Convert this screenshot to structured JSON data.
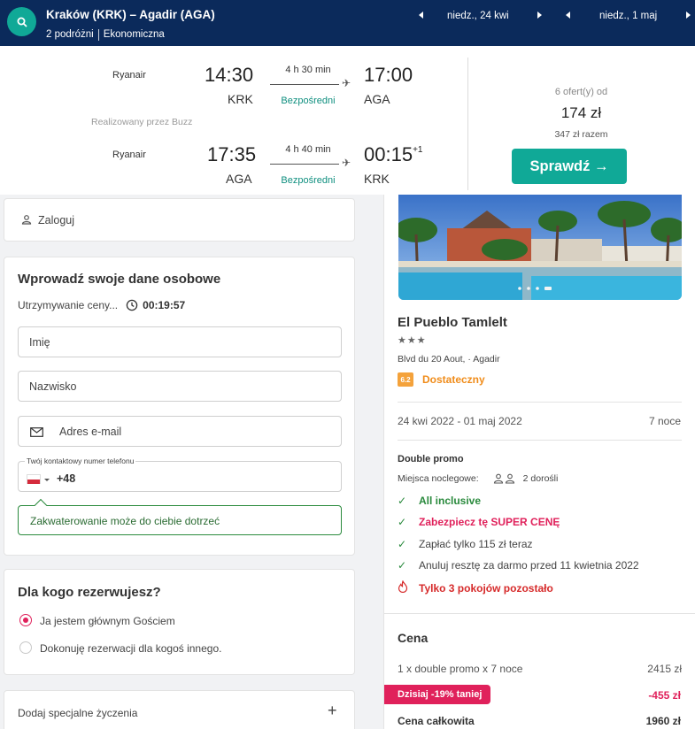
{
  "header": {
    "route": "Kraków (KRK) – Agadir (AGA)",
    "travellers": "2 podróżni",
    "cabin": "Ekonomiczna",
    "depart_date": "niedz., 24 kwi",
    "return_date": "niedz., 1 maj"
  },
  "flight": {
    "outbound": {
      "airline": "Ryanair",
      "dep_time": "14:30",
      "dep_code": "KRK",
      "duration": "4 h 30 min",
      "stops": "Bezpośredni",
      "arr_time": "17:00",
      "arr_code": "AGA"
    },
    "operated_by": "Realizowany przez Buzz",
    "inbound": {
      "airline": "Ryanair",
      "dep_time": "17:35",
      "dep_code": "AGA",
      "duration": "4 h 40 min",
      "stops": "Bezpośredni",
      "arr_time": "00:15",
      "arr_day_offset": "+1",
      "arr_code": "KRK"
    },
    "offers_from": "6 ofert(y) od",
    "price": "174 zł",
    "total": "347 zł razem",
    "check_label": "Sprawdź →"
  },
  "login": {
    "label": "Zaloguj"
  },
  "personal": {
    "title": "Wprowadź swoje dane osobowe",
    "hold_label": "Utrzymywanie ceny...",
    "timer": "00:19:57",
    "first_name_ph": "Imię",
    "last_name_ph": "Nazwisko",
    "email_ph": "Adres e-mail",
    "phone_label": "Twój kontaktowy numer telefonu",
    "phone_prefix": "+48",
    "note": "Zakwaterowanie może do ciebie dotrzeć"
  },
  "forwhom": {
    "title": "Dla kogo rezerwujesz?",
    "option_self": "Ja jestem głównym Gościem",
    "option_other": "Dokonuję rezerwacji dla kogoś innego."
  },
  "wishes": {
    "label": "Dodaj specjalne życzenia",
    "plus": "+"
  },
  "hotel": {
    "name": "El Pueblo Tamlelt",
    "stars": "★★★",
    "address": "Blvd du 20 Aout, · Agadir",
    "score": "6.2",
    "rating": "Dostateczny",
    "dates": "24 kwi 2022 - 01 maj 2022",
    "nights": "7 noce",
    "room": "Double promo",
    "beds_label": "Miejsca noclegowe:",
    "guests": "2 dorośli",
    "features": {
      "all_inclusive": "All inclusive",
      "super_price": "Zabezpiecz tę SUPER CENĘ",
      "pay_now": "Zapłać tylko 115 zł teraz",
      "cancel": "Anuluj resztę za darmo przed 11 kwietnia 2022",
      "rooms_left": "Tylko 3 pokojów pozostało"
    }
  },
  "price": {
    "title": "Cena",
    "line_label": "1 x double promo x 7 noce",
    "line_value": "2415 zł",
    "discount_label": "Dzisiaj -19% taniej",
    "discount_value": "-455 zł",
    "total_label": "Cena całkowita",
    "total_value": "1960 zł"
  },
  "colors": {
    "navy": "#0b2a5b",
    "teal": "#10a997",
    "pink": "#e0215b",
    "green": "#2a8a3d",
    "orange": "#f4a23b"
  }
}
